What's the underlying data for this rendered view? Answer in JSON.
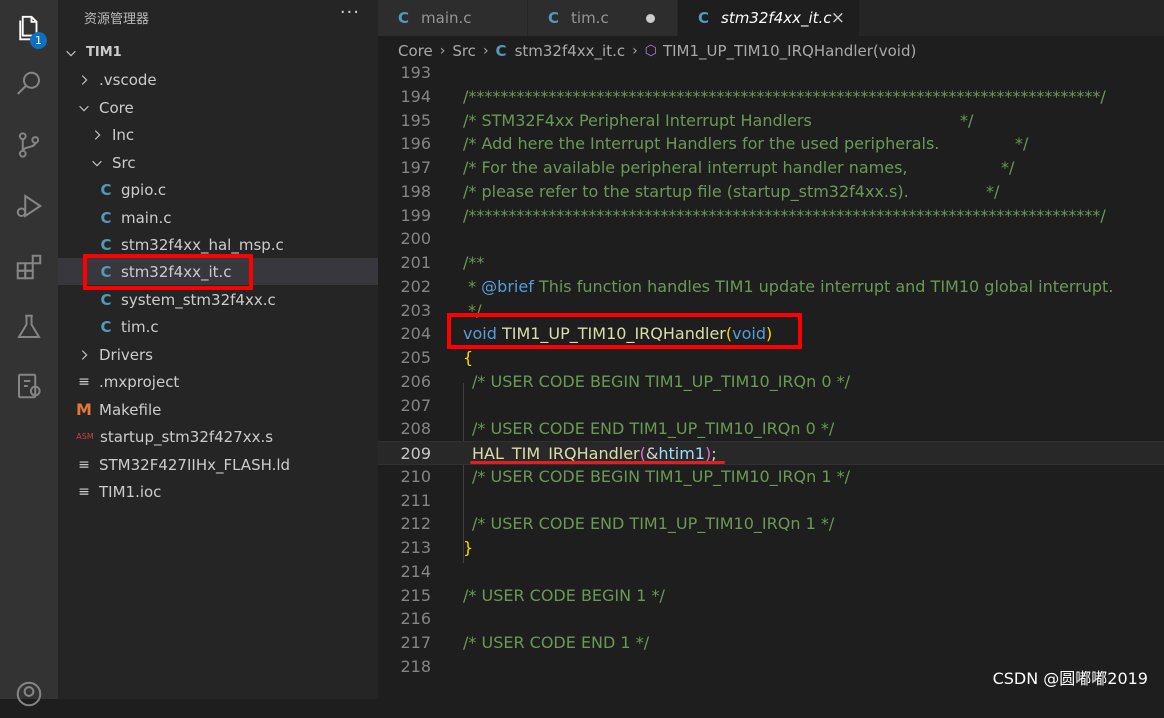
{
  "activity_bar": {
    "explorer_badge": "1",
    "icons": [
      "files-icon",
      "search-icon",
      "source-control-icon",
      "run-debug-icon",
      "extensions-icon",
      "testing-icon",
      "remote-icon",
      "account-icon"
    ]
  },
  "sidebar": {
    "title": "资源管理器",
    "more": "···",
    "tree": [
      {
        "label": "TIM1",
        "type": "root",
        "expanded": true
      },
      {
        "label": ".vscode",
        "type": "folder",
        "expanded": false
      },
      {
        "label": "Core",
        "type": "folder",
        "expanded": true
      },
      {
        "label": "Inc",
        "type": "folder",
        "expanded": false
      },
      {
        "label": "Src",
        "type": "folder",
        "expanded": true
      },
      {
        "label": "gpio.c",
        "type": "c"
      },
      {
        "label": "main.c",
        "type": "c"
      },
      {
        "label": "stm32f4xx_hal_msp.c",
        "type": "c"
      },
      {
        "label": "stm32f4xx_it.c",
        "type": "c",
        "selected": true
      },
      {
        "label": "system_stm32f4xx.c",
        "type": "c"
      },
      {
        "label": "tim.c",
        "type": "c"
      },
      {
        "label": "Drivers",
        "type": "folder",
        "expanded": false
      },
      {
        "label": ".mxproject",
        "type": "lines"
      },
      {
        "label": "Makefile",
        "type": "makefile"
      },
      {
        "label": "startup_stm32f427xx.s",
        "type": "asm"
      },
      {
        "label": "STM32F427IIHx_FLASH.ld",
        "type": "lines"
      },
      {
        "label": "TIM1.ioc",
        "type": "lines"
      }
    ]
  },
  "tabs": [
    {
      "label": "main.c",
      "state": "normal"
    },
    {
      "label": "tim.c",
      "state": "modified"
    },
    {
      "label": "stm32f4xx_it.c",
      "state": "active",
      "close": "×"
    }
  ],
  "breadcrumb": {
    "parts": [
      "Core",
      "Src"
    ],
    "file_icon": "C",
    "file": "stm32f4xx_it.c",
    "symbol": "TIM1_UP_TIM10_IRQHandler(void)"
  },
  "editor": {
    "current_line": "209",
    "lines": [
      {
        "n": "193",
        "t": ""
      },
      {
        "n": "194",
        "t": "/******************************************************************************/"
      },
      {
        "n": "195",
        "t": "/* STM32F4xx Peripheral Interrupt Handlers                                    */"
      },
      {
        "n": "196",
        "t": "/* Add here the Interrupt Handlers for the used peripherals.                  */"
      },
      {
        "n": "197",
        "t": "/* For the available peripheral interrupt handler names,                      */"
      },
      {
        "n": "198",
        "t": "/* please refer to the startup file (startup_stm32f4xx.s).                    */"
      },
      {
        "n": "199",
        "t": "/******************************************************************************/"
      },
      {
        "n": "200",
        "t": ""
      },
      {
        "n": "201",
        "t": "/**"
      },
      {
        "n": "202",
        "t": "  * @brief This function handles TIM1 update interrupt and TIM10 global interrupt."
      },
      {
        "n": "203",
        "t": "  */"
      },
      {
        "n": "204",
        "t": "void TIM1_UP_TIM10_IRQHandler(void)"
      },
      {
        "n": "205",
        "t": "{"
      },
      {
        "n": "206",
        "t": "  /* USER CODE BEGIN TIM1_UP_TIM10_IRQn 0 */"
      },
      {
        "n": "207",
        "t": ""
      },
      {
        "n": "208",
        "t": "  /* USER CODE END TIM1_UP_TIM10_IRQn 0 */"
      },
      {
        "n": "209",
        "t": "  HAL_TIM_IRQHandler(&htim1);"
      },
      {
        "n": "210",
        "t": "  /* USER CODE BEGIN TIM1_UP_TIM10_IRQn 1 */"
      },
      {
        "n": "211",
        "t": ""
      },
      {
        "n": "212",
        "t": "  /* USER CODE END TIM1_UP_TIM10_IRQn 1 */"
      },
      {
        "n": "213",
        "t": "}"
      },
      {
        "n": "214",
        "t": ""
      },
      {
        "n": "215",
        "t": "/* USER CODE BEGIN 1 */"
      },
      {
        "n": "216",
        "t": ""
      },
      {
        "n": "217",
        "t": "/* USER CODE END 1 */"
      },
      {
        "n": "218",
        "t": ""
      }
    ]
  },
  "code_pieces": {
    "l194": "/*******************************************************************************/",
    "l195a": "/* STM32F4xx Peripheral Interrupt Handlers",
    "l195b": "*/",
    "l196a": "/* Add here the Interrupt Handlers for the used peripherals.",
    "l196b": "*/",
    "l197a": "/* For the available peripheral interrupt handler names,",
    "l197b": "*/",
    "l198a": "/* please refer to the startup file (startup_stm32f4xx.s).",
    "l198b": "*/",
    "l199": "/*******************************************************************************/",
    "l201": "/**",
    "l202a": " * ",
    "l202b": "@brief",
    "l202c": " This function handles TIM1 update interrupt and TIM10 global interrupt.",
    "l203": " */",
    "l204_void": "void",
    "l204_name": " TIM1_UP_TIM10_IRQHandler",
    "l204_open": "(",
    "l204_arg": "void",
    "l204_close": ")",
    "l205": "{",
    "l206": "/* USER CODE BEGIN TIM1_UP_TIM10_IRQn 0 */",
    "l208": "/* USER CODE END TIM1_UP_TIM10_IRQn 0 */",
    "l209_fn": "HAL_TIM_IRQHandler",
    "l209_open": "(",
    "l209_amp": "&",
    "l209_var": "htim1",
    "l209_close": ")",
    "l209_semi": ";",
    "l210": "/* USER CODE BEGIN TIM1_UP_TIM10_IRQn 1 */",
    "l212": "/* USER CODE END TIM1_UP_TIM10_IRQn 1 */",
    "l213": "}",
    "l215": "/* USER CODE BEGIN 1 */",
    "l217": "/* USER CODE END 1 */"
  },
  "watermark": "CSDN @圆嘟嘟2019",
  "colors": {
    "comment": "#6a9955",
    "keyword": "#569cd6",
    "function": "#dcdcaa",
    "variable": "#9cdcfe",
    "annotation": "#ff0000"
  }
}
